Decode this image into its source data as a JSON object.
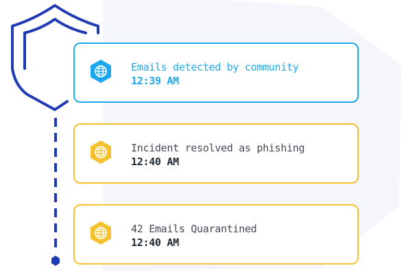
{
  "colors": {
    "blue_accent": "#1ba8ee",
    "yellow_accent": "#f5c12e",
    "navy": "#1f3bb3",
    "background_shape": "#f4f6fb"
  },
  "timeline": {
    "events": [
      {
        "title": "Emails detected by community",
        "time": "12:39 AM",
        "icon": "globe-icon",
        "status": "detected"
      },
      {
        "title": "Incident resolved as phishing",
        "time": "12:40 AM",
        "icon": "globe-icon",
        "status": "resolved"
      },
      {
        "title": "42 Emails Quarantined",
        "time": "12:40 AM",
        "icon": "globe-icon",
        "status": "quarantined"
      }
    ]
  }
}
